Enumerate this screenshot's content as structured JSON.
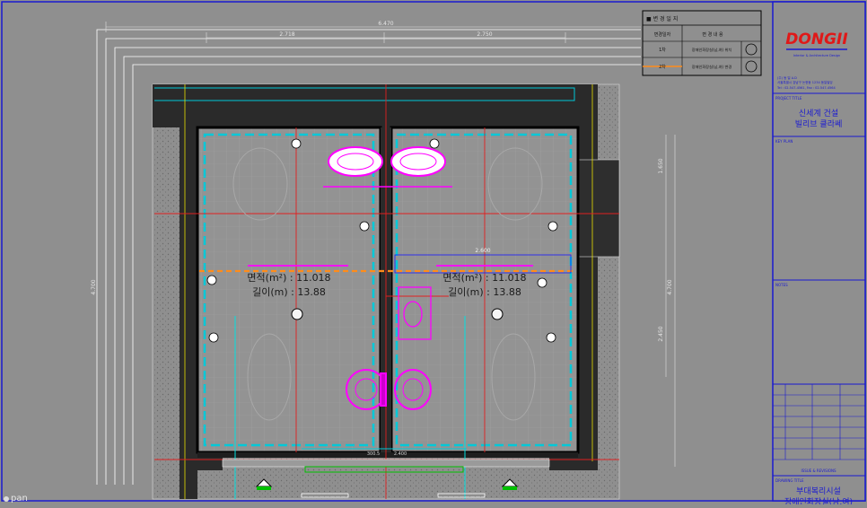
{
  "status": {
    "mode_label": "pan"
  },
  "rooms": [
    {
      "area_label": "면적(m²) : 11.018",
      "length_label": "길이(m) : 13.88"
    },
    {
      "area_label": "면적(m²) : 11.018",
      "length_label": "길이(m) : 13.88"
    }
  ],
  "dimensions": {
    "top_total": "6.470",
    "top_left": "2.718",
    "top_right": "2.750",
    "left_side": "4.700",
    "right_top": "1.650",
    "right_mid": "4.700",
    "right_low": "2.450",
    "inner_width": "2.600",
    "bottom_a": "300.5",
    "bottom_b": "2.400"
  },
  "revision_table": {
    "title": "■ 변 경 일 지",
    "header_col1": "변경일자",
    "header_col2": "변 경 내 용",
    "row1_col1": "1차",
    "row1_col2": "장애인화장실(남,여) 위치",
    "row2_col1": "2차",
    "row2_col2": "장애인화장실(남,여) 변경"
  },
  "title_block": {
    "logo_text": "DONGII",
    "logo_sub": "Interior & Architecture Design",
    "company_line1": "(주) 동 일 A.D",
    "company_line2": "서울특별시 강남구 논현동 1234 동일빌딩",
    "company_line3": "Tel : 02-547-4561, Fax : 02-547-4564",
    "project_title_label": "PROJECT TITLE",
    "project_name_1": "신세계 건설",
    "project_name_2": "빌리브 클라쎄",
    "key_plan_label": "KEY PLAN",
    "notes_label": "NOTES",
    "issue_label": "ISSUE & REVISIONS",
    "drawing_title_label": "DRAWING TITLE",
    "drawing_name_1": "부대복리시설",
    "drawing_name_2": "장애인화장실(남,여)"
  },
  "colors": {
    "canvas": "#8f8f8f",
    "wall": "#2a2a2a",
    "cyan": "#00c8d8",
    "magenta": "#ff00ff",
    "orange": "#ff8c1a",
    "red": "#e02020",
    "yellow": "#e8e000",
    "blue": "#0000ff",
    "logo_red": "#e01818"
  }
}
